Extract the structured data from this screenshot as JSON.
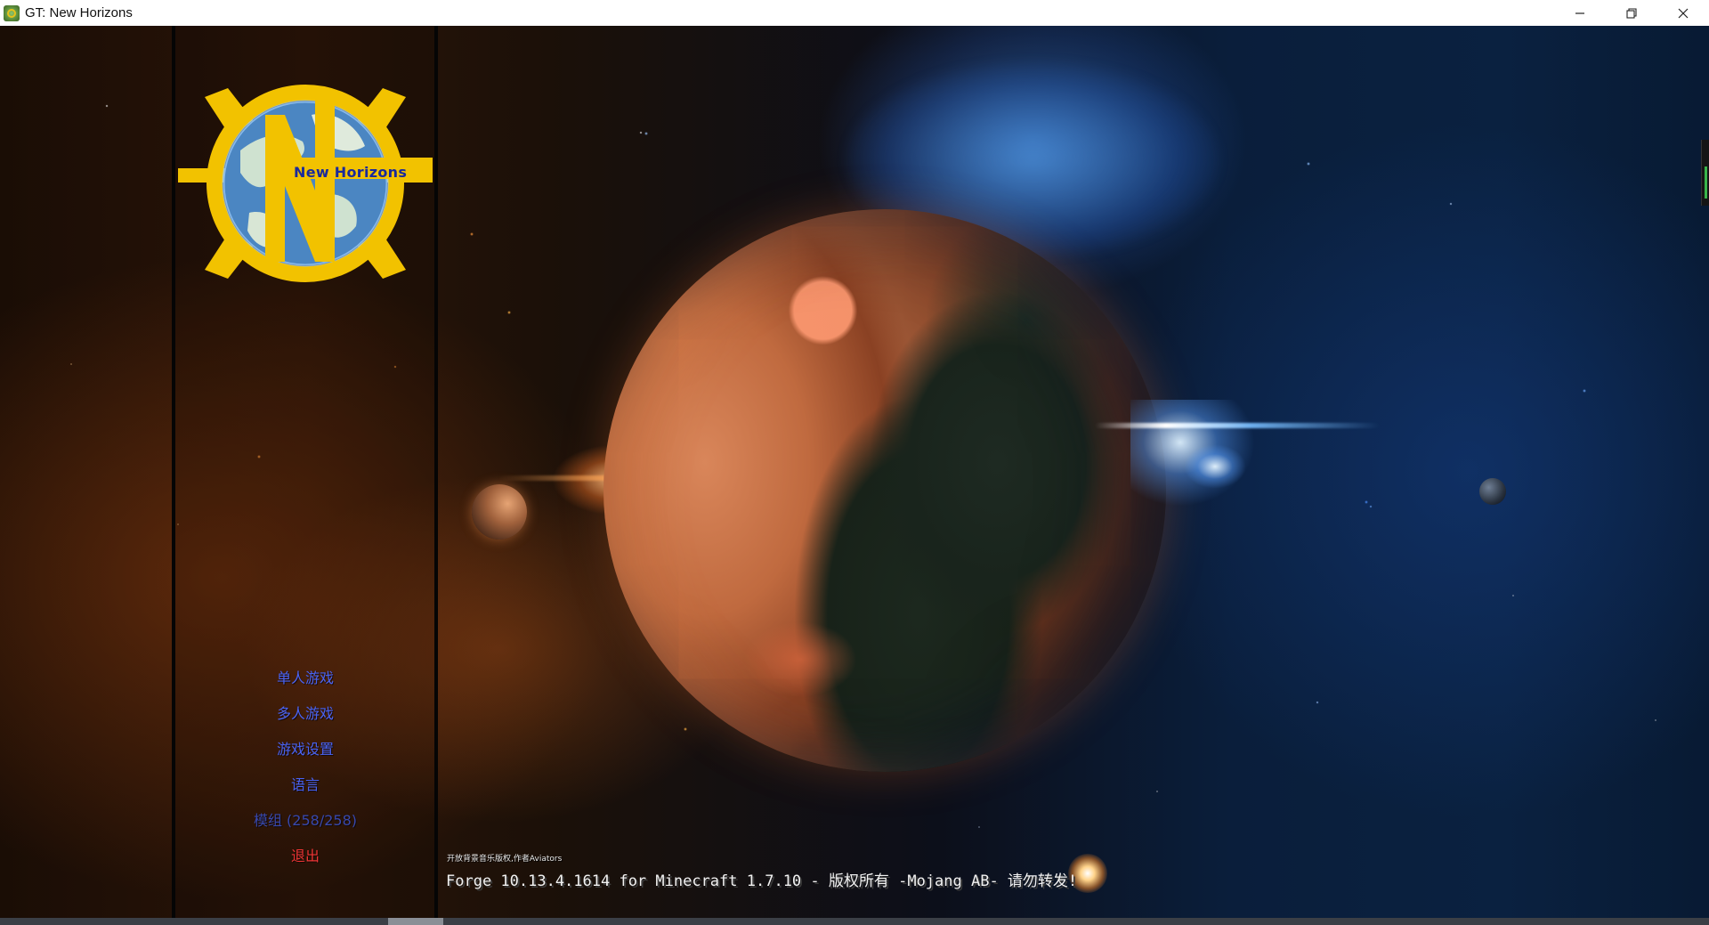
{
  "window": {
    "title": "GT: New Horizons",
    "controls": {
      "minimize_icon": "minimize-icon",
      "restore_icon": "restore-icon",
      "close_icon": "close-icon"
    }
  },
  "logo": {
    "text": "New Horizons",
    "colors": {
      "gear": "#f2c200",
      "text": "#1a2a9c"
    }
  },
  "menu": {
    "items": [
      {
        "label": "单人游戏",
        "color": "#4a63f2"
      },
      {
        "label": "多人游戏",
        "color": "#4a63f2"
      },
      {
        "label": "游戏设置",
        "color": "#4a63f2"
      },
      {
        "label": "语言",
        "color": "#4a63f2"
      },
      {
        "label": "模组 (258/258)",
        "color": "#3848ad"
      },
      {
        "label": "退出",
        "color": "#ef3535"
      }
    ]
  },
  "footer": {
    "music_credit": "开放背景音乐版权,作者Aviators",
    "version": "Forge 10.13.4.1614 for Minecraft 1.7.10 - 版权所有 -Mojang AB- 请勿转发!"
  }
}
